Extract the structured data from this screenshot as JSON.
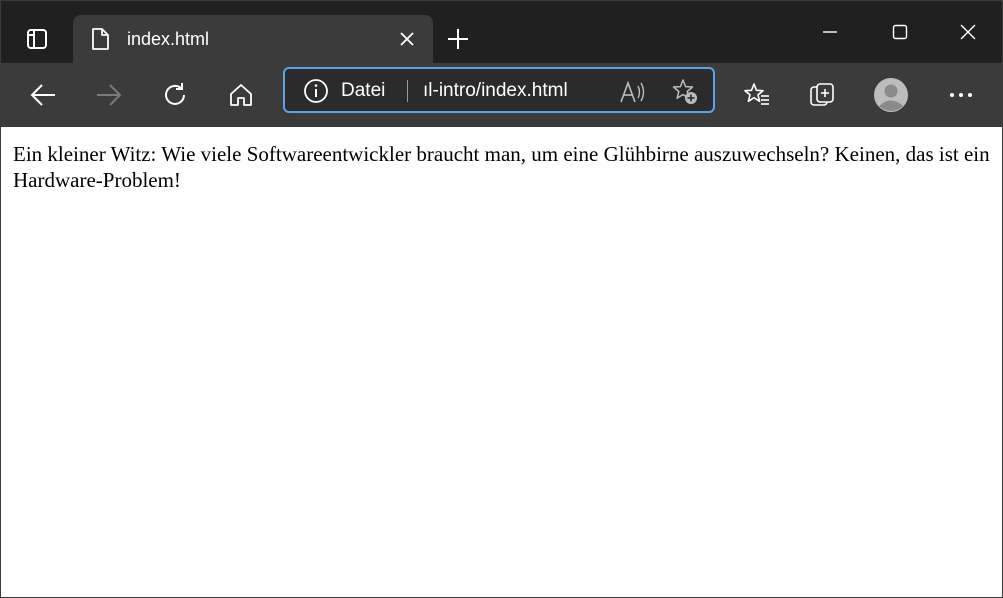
{
  "tab": {
    "title": "index.html"
  },
  "addressbar": {
    "scheme_label": "Datei",
    "url": "ıl-intro/index.html"
  },
  "icons": {
    "tab_actions": "tab-actions-icon",
    "favicon": "document-icon",
    "tab_close": "close-icon",
    "new_tab": "plus-icon",
    "minimize": "minimize-icon",
    "maximize": "maximize-icon",
    "window_close": "close-icon",
    "back": "arrow-left-icon",
    "forward": "arrow-right-icon",
    "refresh": "refresh-icon",
    "home": "home-icon",
    "site_info": "info-icon",
    "read_aloud": "read-aloud-icon",
    "add_favorite": "star-add-icon",
    "favorites": "favorites-icon",
    "collections": "collections-icon",
    "profile": "avatar-icon",
    "more": "more-icon"
  },
  "colors": {
    "tabstrip_bg": "#202020",
    "toolbar_bg": "#3b3b3b",
    "address_focus": "#5aa3e8",
    "content_bg": "#ffffff"
  },
  "page": {
    "text": "Ein kleiner Witz: Wie viele Softwareentwickler braucht man, um eine Glühbirne auszuwechseln? Keinen, das ist ein Hardware-Problem!"
  }
}
